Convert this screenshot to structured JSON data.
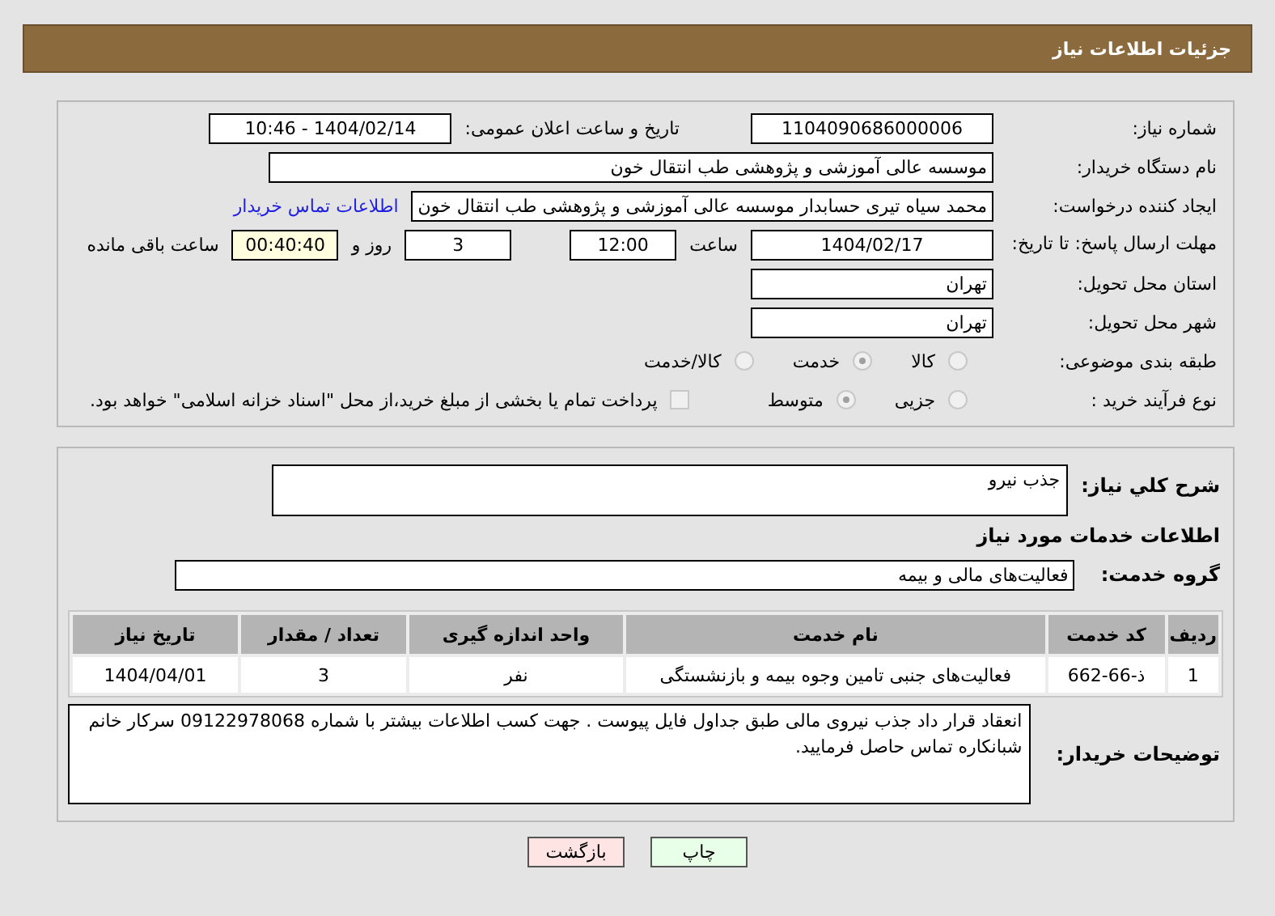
{
  "window": {
    "title": "جزئیات اطلاعات نیاز"
  },
  "need_number": {
    "label": "شماره نیاز:",
    "value": "1104090686000006"
  },
  "announce": {
    "label": "تاریخ و ساعت اعلان عمومی:",
    "value": "1404/02/14 - 10:46"
  },
  "buyer_org": {
    "label": "نام دستگاه خریدار:",
    "value": "موسسه عالی آموزشی و پژوهشی طب انتقال خون"
  },
  "requester": {
    "label": "ایجاد کننده درخواست:",
    "value": "محمد سیاه تیری حسابدار موسسه عالی آموزشی و پژوهشی طب انتقال خون",
    "link": "اطلاعات تماس خریدار"
  },
  "deadline": {
    "label": "مهلت ارسال پاسخ: تا تاریخ:",
    "date": "1404/02/17",
    "time_label": "ساعت",
    "time": "12:00",
    "days": "3",
    "days_label": "روز و",
    "remaining": "00:40:40",
    "remaining_label": "ساعت باقی مانده"
  },
  "province": {
    "label": "استان محل تحویل:",
    "value": "تهران"
  },
  "city": {
    "label": "شهر محل تحویل:",
    "value": "تهران"
  },
  "category": {
    "label": "طبقه بندی موضوعی:",
    "options": [
      {
        "label": "کالا",
        "selected": false
      },
      {
        "label": "خدمت",
        "selected": true
      },
      {
        "label": "کالا/خدمت",
        "selected": false
      }
    ]
  },
  "process": {
    "label": "نوع فرآیند خرید :",
    "options": [
      {
        "label": "جزیی",
        "selected": false
      },
      {
        "label": "متوسط",
        "selected": true
      }
    ],
    "payment": {
      "label": "پرداخت تمام یا بخشی از مبلغ خرید،از محل \"اسناد خزانه اسلامی\" خواهد بود.",
      "checked": false
    }
  },
  "description": {
    "label": "شرح کلي نیاز:",
    "value": "جذب نیرو"
  },
  "services_heading": "اطلاعات خدمات مورد نیاز",
  "service_group": {
    "label": "گروه خدمت:",
    "value": "فعالیت‌های مالی و بیمه"
  },
  "table": {
    "columns": [
      "ردیف",
      "کد خدمت",
      "نام خدمت",
      "واحد اندازه گیری",
      "تعداد / مقدار",
      "تاریخ نیاز"
    ],
    "rows": [
      [
        "1",
        "ذ-66-662",
        "فعالیت‌های جنبی تامین وجوه بیمه و بازنشستگی",
        "نفر",
        "3",
        "1404/04/01"
      ]
    ]
  },
  "buyer_notes": {
    "label": "توضیحات خریدار:",
    "value": "انعقاد قرار داد جذب نیروی مالی طبق جداول فایل پیوست . جهت کسب اطلاعات بیشتر با شماره 09122978068 سرکار خانم شبانکاره تماس حاصل فرمایید."
  },
  "buttons": [
    {
      "label": "چاپ",
      "kind": "print"
    },
    {
      "label": "بازگشت",
      "kind": "back"
    }
  ]
}
